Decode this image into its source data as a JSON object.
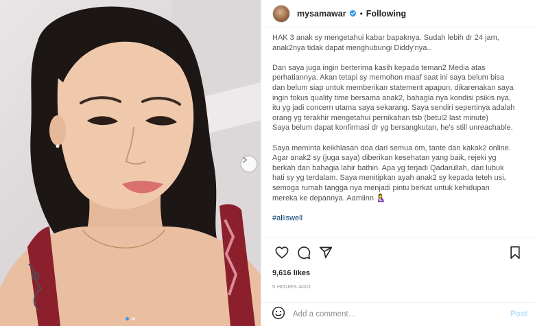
{
  "post": {
    "photo_alt_icon": "post-photo",
    "photo_count": 2,
    "photo_index": 1
  },
  "header": {
    "username": "mysamawar",
    "separator": "•",
    "follow_status": "Following"
  },
  "caption": {
    "paragraphs": [
      "HAK 3 anak sy mengetahui kabar bapaknya. Sudah lebih dr 24 jam, anak2nya tidak dapat menghubungi Diddy'nya..",
      "Dan saya juga ingin berterima kasih kepada teman2 Media atas perhatiannya. Akan tetapi sy memohon maaf saat ini saya belum bisa dan belum siap untuk memberikan statement apapun, dikarenakan saya ingin fokus quality time bersama anak2, bahagia nya kondisi psikis nya, itu yg jadi concern utama saya sekarang. Saya sendiri sepertinya adalah orang yg terakhir mengetahui pernikahan tsb (betul2 last minute)\nSaya belum dapat konfirmasi dr yg bersangkutan, he's still unreachable.",
      "Saya meminta keikhlasan doa dari semua om, tante dan kakak2 online. Agar anak2 sy (juga saya) diberikan kesehatan yang baik, rejeki yg berkah dan bahagia lahir bathin. Apa yg terjadi Qadarullah, dari lubuk hati sy yg terdalam. Saya menitipkan ayah anak2 sy kepada teteh usi, semoga rumah tangga nya menjadi pintu berkat untuk kehidupan mereka ke depannya. Aamiinn"
    ],
    "closing_emoji": "🤱",
    "hashtag": "#alliswell"
  },
  "actions": {
    "like_icon": "heart-icon",
    "comment_icon": "comment-icon",
    "share_icon": "send-icon",
    "save_icon": "bookmark-icon"
  },
  "stats": {
    "likes": "9,616 likes",
    "time": "5 HOURS AGO"
  },
  "comment": {
    "placeholder": "Add a comment…",
    "post_label": "Post"
  },
  "colors": {
    "verified": "#3897f0",
    "hashtag": "#00376b",
    "post_disabled": "#b2dffc",
    "meta": "#8e8e8e"
  }
}
